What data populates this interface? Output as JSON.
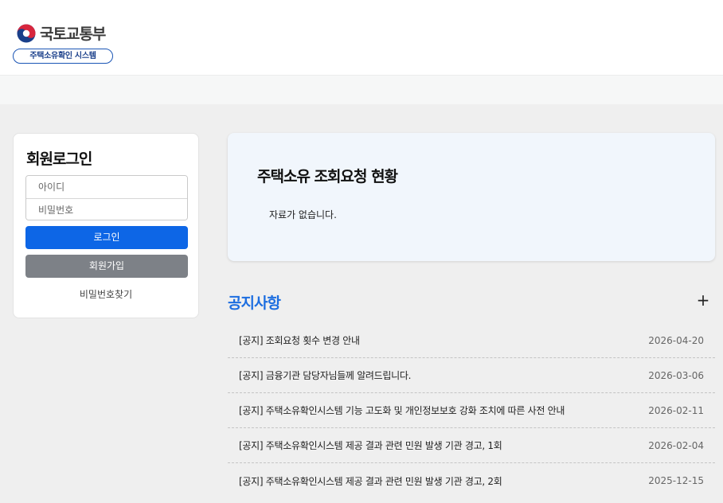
{
  "header": {
    "logo_text": "국토교통부",
    "system_badge": "주택소유확인 시스템"
  },
  "login": {
    "title": "회원로그인",
    "id_placeholder": "아이디",
    "pw_placeholder": "비밀번호",
    "login_label": "로그인",
    "join_label": "회원가입",
    "find_pw_label": "비밀번호찾기"
  },
  "status": {
    "title": "주택소유 조회요청 현황",
    "empty_message": "자료가 없습니다."
  },
  "notices": {
    "title": "공지사항",
    "more_icon": "plus-icon",
    "items": [
      {
        "title": "[공지] 조회요청 횟수 변경 안내",
        "date": "2026-04-20"
      },
      {
        "title": "[공지] 금융기관 담당자님들께 알려드립니다.",
        "date": "2026-03-06"
      },
      {
        "title": "[공지] 주택소유확인시스템 기능 고도화 및 개인정보보호 강화 조치에 따른 사전 안내",
        "date": "2026-02-11"
      },
      {
        "title": "[공지] 주택소유확인시스템 제공 결과 관련 민원 발생 기관 경고, 1회",
        "date": "2026-02-04"
      },
      {
        "title": "[공지] 주택소유확인시스템 제공 결과 관련 민원 발생 기관 경고, 2회",
        "date": "2025-12-15"
      }
    ]
  },
  "colors": {
    "primary": "#0d66e6",
    "secondary": "#7d8187",
    "notice_title": "#1d6ee0",
    "status_bg": "#f1f6fc",
    "page_bg": "#efefef"
  }
}
